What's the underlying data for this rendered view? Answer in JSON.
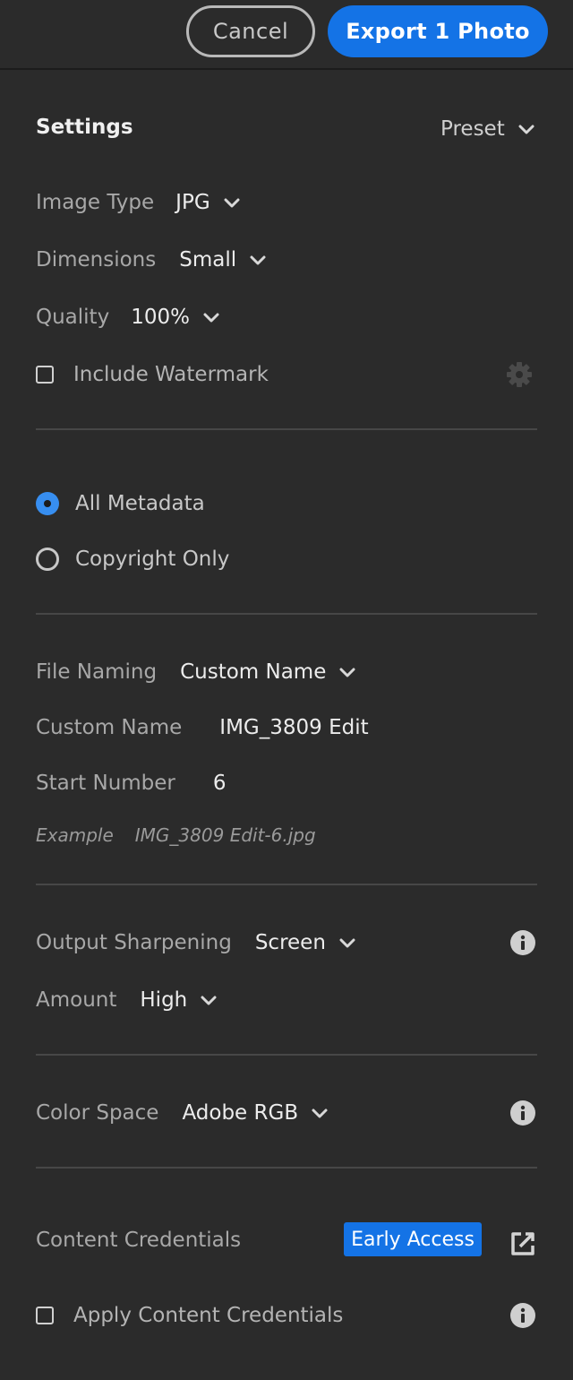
{
  "toolbar": {
    "cancel_label": "Cancel",
    "export_label": "Export 1 Photo"
  },
  "settings": {
    "title": "Settings",
    "preset_label": "Preset",
    "image_type": {
      "label": "Image Type",
      "value": "JPG"
    },
    "dimensions": {
      "label": "Dimensions",
      "value": "Small"
    },
    "quality": {
      "label": "Quality",
      "value": "100%"
    },
    "watermark": {
      "label": "Include Watermark",
      "checked": false
    }
  },
  "metadata": {
    "options": [
      {
        "label": "All Metadata",
        "selected": true
      },
      {
        "label": "Copyright Only",
        "selected": false
      }
    ]
  },
  "file_naming": {
    "naming": {
      "label": "File Naming",
      "value": "Custom Name"
    },
    "custom_name": {
      "label": "Custom Name",
      "value": "IMG_3809 Edit"
    },
    "start_number": {
      "label": "Start Number",
      "value": "6"
    },
    "example": {
      "label": "Example",
      "value": "IMG_3809 Edit-6.jpg"
    }
  },
  "sharpening": {
    "output": {
      "label": "Output Sharpening",
      "value": "Screen"
    },
    "amount": {
      "label": "Amount",
      "value": "High"
    }
  },
  "color_space": {
    "label": "Color Space",
    "value": "Adobe RGB"
  },
  "content_credentials": {
    "label": "Content Credentials",
    "badge": "Early Access",
    "apply_label": "Apply Content Credentials",
    "apply_checked": false
  },
  "colors": {
    "accent": "#1473e6",
    "background": "#2b2b2b",
    "radio_selected": "#378ef0"
  },
  "icons": {
    "gear": "gear-icon",
    "info": "info-icon",
    "external": "external-link-icon",
    "chevron": "chevron-down-icon"
  }
}
